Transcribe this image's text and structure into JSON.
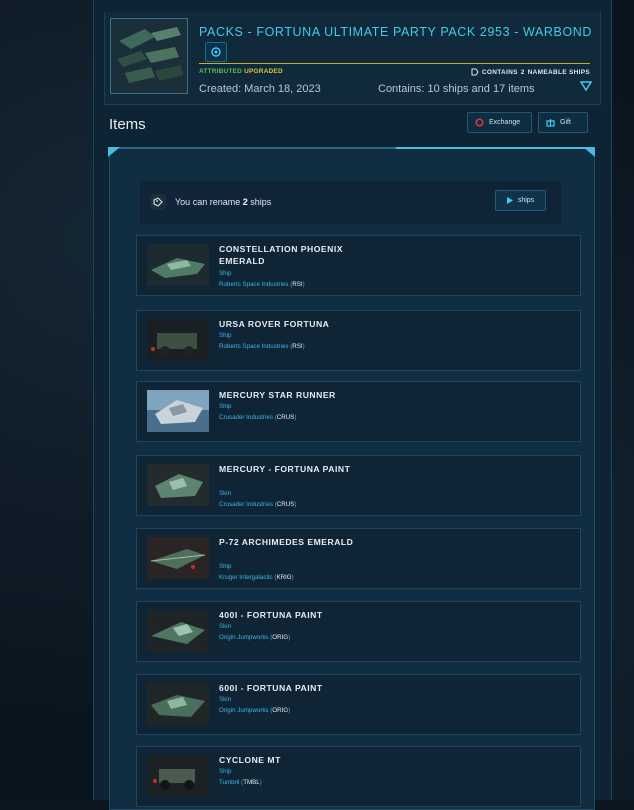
{
  "pack": {
    "title": "PACKS - FORTUNA ULTIMATE PARTY PACK 2953 - WARBOND",
    "badge_attributed": "ATTRIBUTED",
    "badge_upgraded": "UPGRADED",
    "contains_named_prefix": "CONTAINS",
    "contains_named_count": "2",
    "contains_named_suffix": "NAMEABLE SHIPS",
    "created": "Created: March 18, 2023",
    "contains": "Contains: 10 ships and 17 items"
  },
  "items_heading": "Items",
  "actions": {
    "exchange_label": "Exchange",
    "gift_label": "Gift"
  },
  "rename": {
    "prefix": "You can rename",
    "count": "2",
    "suffix": "ships",
    "button_label": "ships"
  },
  "items": [
    {
      "name": "CONSTELLATION PHOENIX EMERALD",
      "type": "Ship",
      "manufacturer": "Roberts Space Industries",
      "code": "RSI"
    },
    {
      "name": "URSA ROVER FORTUNA",
      "type": "Ship",
      "manufacturer": "Roberts Space Industries",
      "code": "RSI"
    },
    {
      "name": "MERCURY STAR RUNNER",
      "type": "Ship",
      "manufacturer": "Crusader Industries",
      "code": "CRUS"
    },
    {
      "name": "MERCURY - FORTUNA PAINT",
      "type": "Skin",
      "manufacturer": "Crusader Industries",
      "code": "CRUS"
    },
    {
      "name": "P-72 ARCHIMEDES EMERALD",
      "type": "Ship",
      "manufacturer": "Kruger Intergalactic",
      "code": "KRIG"
    },
    {
      "name": "400I - FORTUNA PAINT",
      "type": "Skin",
      "manufacturer": "Origin Jumpworks",
      "code": "ORIG"
    },
    {
      "name": "600I - FORTUNA PAINT",
      "type": "Skin",
      "manufacturer": "Origin Jumpworks",
      "code": "ORIG"
    },
    {
      "name": "CYCLONE MT",
      "type": "Ship",
      "manufacturer": "Tumbril",
      "code": "TMBL"
    }
  ],
  "colors": {
    "accent": "#45c9f0",
    "attributed": "#54c04e",
    "upgraded": "#d9c832"
  }
}
